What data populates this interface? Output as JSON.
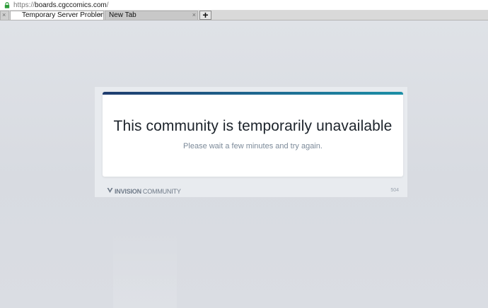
{
  "browser": {
    "url": {
      "scheme": "https://",
      "host": "boards.cgccomics.com",
      "path": "/"
    },
    "tabs": [
      {
        "label": "Temporary Server Problem",
        "active": true
      },
      {
        "label": "New Tab",
        "active": false
      }
    ],
    "close_glyph": "×",
    "new_tab_glyph": "+"
  },
  "page": {
    "heading": "This community is temporarily unavailable",
    "message": "Please wait a few minutes and try again.",
    "brand": {
      "strong": "INVISION",
      "light": "COMMUNITY"
    },
    "error_code": "504"
  },
  "colors": {
    "accent_start": "#1f3c6e",
    "accent_end": "#1c8fa6",
    "heading": "#1c232b",
    "message": "#7c8a99",
    "background": "#dfe2e7"
  }
}
